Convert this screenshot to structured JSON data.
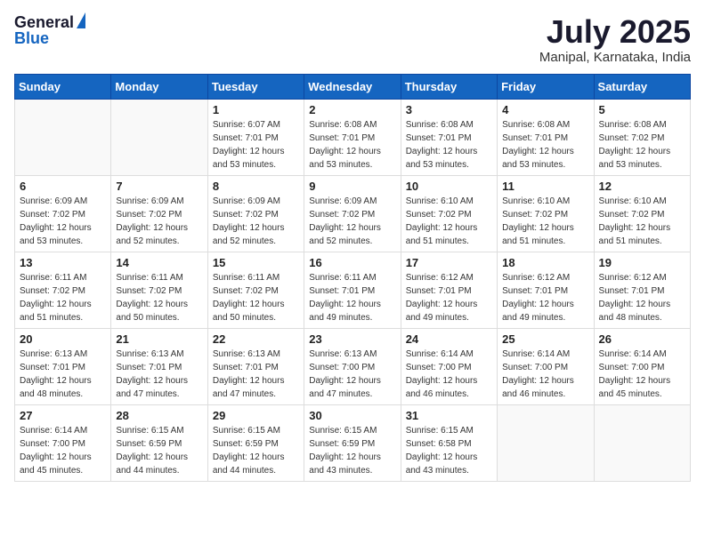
{
  "header": {
    "logo_general": "General",
    "logo_blue": "Blue",
    "month_year": "July 2025",
    "location": "Manipal, Karnataka, India"
  },
  "weekdays": [
    "Sunday",
    "Monday",
    "Tuesday",
    "Wednesday",
    "Thursday",
    "Friday",
    "Saturday"
  ],
  "weeks": [
    [
      {
        "day": "",
        "detail": ""
      },
      {
        "day": "",
        "detail": ""
      },
      {
        "day": "1",
        "detail": "Sunrise: 6:07 AM\nSunset: 7:01 PM\nDaylight: 12 hours and 53 minutes."
      },
      {
        "day": "2",
        "detail": "Sunrise: 6:08 AM\nSunset: 7:01 PM\nDaylight: 12 hours and 53 minutes."
      },
      {
        "day": "3",
        "detail": "Sunrise: 6:08 AM\nSunset: 7:01 PM\nDaylight: 12 hours and 53 minutes."
      },
      {
        "day": "4",
        "detail": "Sunrise: 6:08 AM\nSunset: 7:01 PM\nDaylight: 12 hours and 53 minutes."
      },
      {
        "day": "5",
        "detail": "Sunrise: 6:08 AM\nSunset: 7:02 PM\nDaylight: 12 hours and 53 minutes."
      }
    ],
    [
      {
        "day": "6",
        "detail": "Sunrise: 6:09 AM\nSunset: 7:02 PM\nDaylight: 12 hours and 53 minutes."
      },
      {
        "day": "7",
        "detail": "Sunrise: 6:09 AM\nSunset: 7:02 PM\nDaylight: 12 hours and 52 minutes."
      },
      {
        "day": "8",
        "detail": "Sunrise: 6:09 AM\nSunset: 7:02 PM\nDaylight: 12 hours and 52 minutes."
      },
      {
        "day": "9",
        "detail": "Sunrise: 6:09 AM\nSunset: 7:02 PM\nDaylight: 12 hours and 52 minutes."
      },
      {
        "day": "10",
        "detail": "Sunrise: 6:10 AM\nSunset: 7:02 PM\nDaylight: 12 hours and 51 minutes."
      },
      {
        "day": "11",
        "detail": "Sunrise: 6:10 AM\nSunset: 7:02 PM\nDaylight: 12 hours and 51 minutes."
      },
      {
        "day": "12",
        "detail": "Sunrise: 6:10 AM\nSunset: 7:02 PM\nDaylight: 12 hours and 51 minutes."
      }
    ],
    [
      {
        "day": "13",
        "detail": "Sunrise: 6:11 AM\nSunset: 7:02 PM\nDaylight: 12 hours and 51 minutes."
      },
      {
        "day": "14",
        "detail": "Sunrise: 6:11 AM\nSunset: 7:02 PM\nDaylight: 12 hours and 50 minutes."
      },
      {
        "day": "15",
        "detail": "Sunrise: 6:11 AM\nSunset: 7:02 PM\nDaylight: 12 hours and 50 minutes."
      },
      {
        "day": "16",
        "detail": "Sunrise: 6:11 AM\nSunset: 7:01 PM\nDaylight: 12 hours and 49 minutes."
      },
      {
        "day": "17",
        "detail": "Sunrise: 6:12 AM\nSunset: 7:01 PM\nDaylight: 12 hours and 49 minutes."
      },
      {
        "day": "18",
        "detail": "Sunrise: 6:12 AM\nSunset: 7:01 PM\nDaylight: 12 hours and 49 minutes."
      },
      {
        "day": "19",
        "detail": "Sunrise: 6:12 AM\nSunset: 7:01 PM\nDaylight: 12 hours and 48 minutes."
      }
    ],
    [
      {
        "day": "20",
        "detail": "Sunrise: 6:13 AM\nSunset: 7:01 PM\nDaylight: 12 hours and 48 minutes."
      },
      {
        "day": "21",
        "detail": "Sunrise: 6:13 AM\nSunset: 7:01 PM\nDaylight: 12 hours and 47 minutes."
      },
      {
        "day": "22",
        "detail": "Sunrise: 6:13 AM\nSunset: 7:01 PM\nDaylight: 12 hours and 47 minutes."
      },
      {
        "day": "23",
        "detail": "Sunrise: 6:13 AM\nSunset: 7:00 PM\nDaylight: 12 hours and 47 minutes."
      },
      {
        "day": "24",
        "detail": "Sunrise: 6:14 AM\nSunset: 7:00 PM\nDaylight: 12 hours and 46 minutes."
      },
      {
        "day": "25",
        "detail": "Sunrise: 6:14 AM\nSunset: 7:00 PM\nDaylight: 12 hours and 46 minutes."
      },
      {
        "day": "26",
        "detail": "Sunrise: 6:14 AM\nSunset: 7:00 PM\nDaylight: 12 hours and 45 minutes."
      }
    ],
    [
      {
        "day": "27",
        "detail": "Sunrise: 6:14 AM\nSunset: 7:00 PM\nDaylight: 12 hours and 45 minutes."
      },
      {
        "day": "28",
        "detail": "Sunrise: 6:15 AM\nSunset: 6:59 PM\nDaylight: 12 hours and 44 minutes."
      },
      {
        "day": "29",
        "detail": "Sunrise: 6:15 AM\nSunset: 6:59 PM\nDaylight: 12 hours and 44 minutes."
      },
      {
        "day": "30",
        "detail": "Sunrise: 6:15 AM\nSunset: 6:59 PM\nDaylight: 12 hours and 43 minutes."
      },
      {
        "day": "31",
        "detail": "Sunrise: 6:15 AM\nSunset: 6:58 PM\nDaylight: 12 hours and 43 minutes."
      },
      {
        "day": "",
        "detail": ""
      },
      {
        "day": "",
        "detail": ""
      }
    ]
  ]
}
